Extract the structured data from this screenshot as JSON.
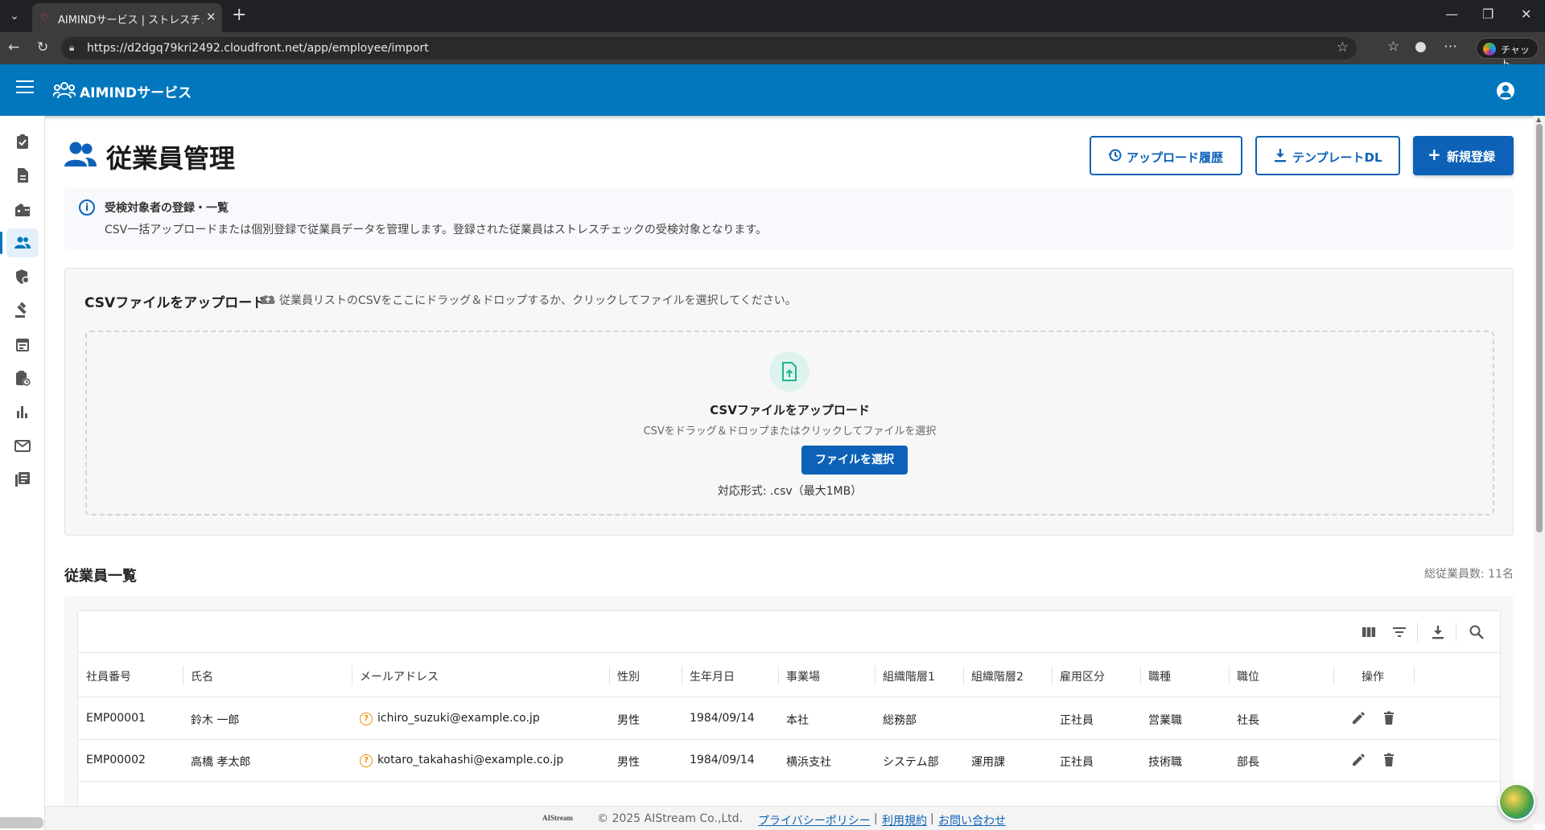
{
  "browser": {
    "tab_title": "AIMINDサービス | ストレスチェック×デジ",
    "url": "https://d2dgq79kri2492.cloudfront.net/app/employee/import",
    "chat_label": "チャット"
  },
  "app": {
    "brand": "AIMINDサービス"
  },
  "sidebar": {
    "items": [
      {
        "icon": "clipboard-check-icon"
      },
      {
        "icon": "document-icon"
      },
      {
        "icon": "building-icon"
      },
      {
        "icon": "people-icon",
        "active": true
      },
      {
        "icon": "shield-settings-icon"
      },
      {
        "icon": "gavel-icon"
      },
      {
        "icon": "calendar-icon"
      },
      {
        "icon": "clipboard-clock-icon"
      },
      {
        "icon": "bar-chart-icon"
      },
      {
        "icon": "mail-icon"
      },
      {
        "icon": "library-books-icon"
      }
    ]
  },
  "page": {
    "title": "従業員管理",
    "buttons": {
      "upload_history": "アップロード履歴",
      "template_dl": "テンプレートDL",
      "new_register": "新規登録"
    }
  },
  "info": {
    "title": "受検対象者の登録・一覧",
    "description": "CSV一括アップロードまたは個別登録で従業員データを管理します。登録された従業員はストレスチェックの受検対象となります。"
  },
  "upload": {
    "heading": "CSVファイルをアップロード",
    "hint": "従業員リストのCSVをここにドラッグ＆ドロップするか、クリックしてファイルを選択してください。",
    "dropzone_title": "CSVファイルをアップロード",
    "dropzone_sub": "CSVをドラッグ＆ドロップまたはクリックしてファイルを選択",
    "select_button": "ファイルを選択",
    "format_note": "対応形式: .csv（最大1MB）"
  },
  "employee_list": {
    "title": "従業員一覧",
    "total": "総従業員数: 11名",
    "columns": [
      "社員番号",
      "氏名",
      "メールアドレス",
      "性別",
      "生年月日",
      "事業場",
      "組織階層1",
      "組織階層2",
      "雇用区分",
      "職種",
      "職位",
      "操作"
    ],
    "rows": [
      {
        "id": "EMP00001",
        "name": "鈴木 一郎",
        "email": "ichiro_suzuki@example.co.jp",
        "gender": "男性",
        "birth": "1984/09/14",
        "site": "本社",
        "org1": "総務部",
        "org2": "",
        "employment": "正社員",
        "job": "営業職",
        "position": "社長"
      },
      {
        "id": "EMP00002",
        "name": "高橋 孝太郎",
        "email": "kotaro_takahashi@example.co.jp",
        "gender": "男性",
        "birth": "1984/09/14",
        "site": "横浜支社",
        "org1": "システム部",
        "org2": "運用課",
        "employment": "正社員",
        "job": "技術職",
        "position": "部長"
      }
    ]
  },
  "footer": {
    "logo": "AIStream",
    "copyright": "© 2025 AIStream Co.,Ltd.",
    "links": [
      "プライバシーポリシー",
      "利用規約",
      "お問い合わせ"
    ]
  },
  "colors": {
    "primary": "#0d62b8",
    "appbar": "#0277bd",
    "warning": "#f08c00"
  }
}
